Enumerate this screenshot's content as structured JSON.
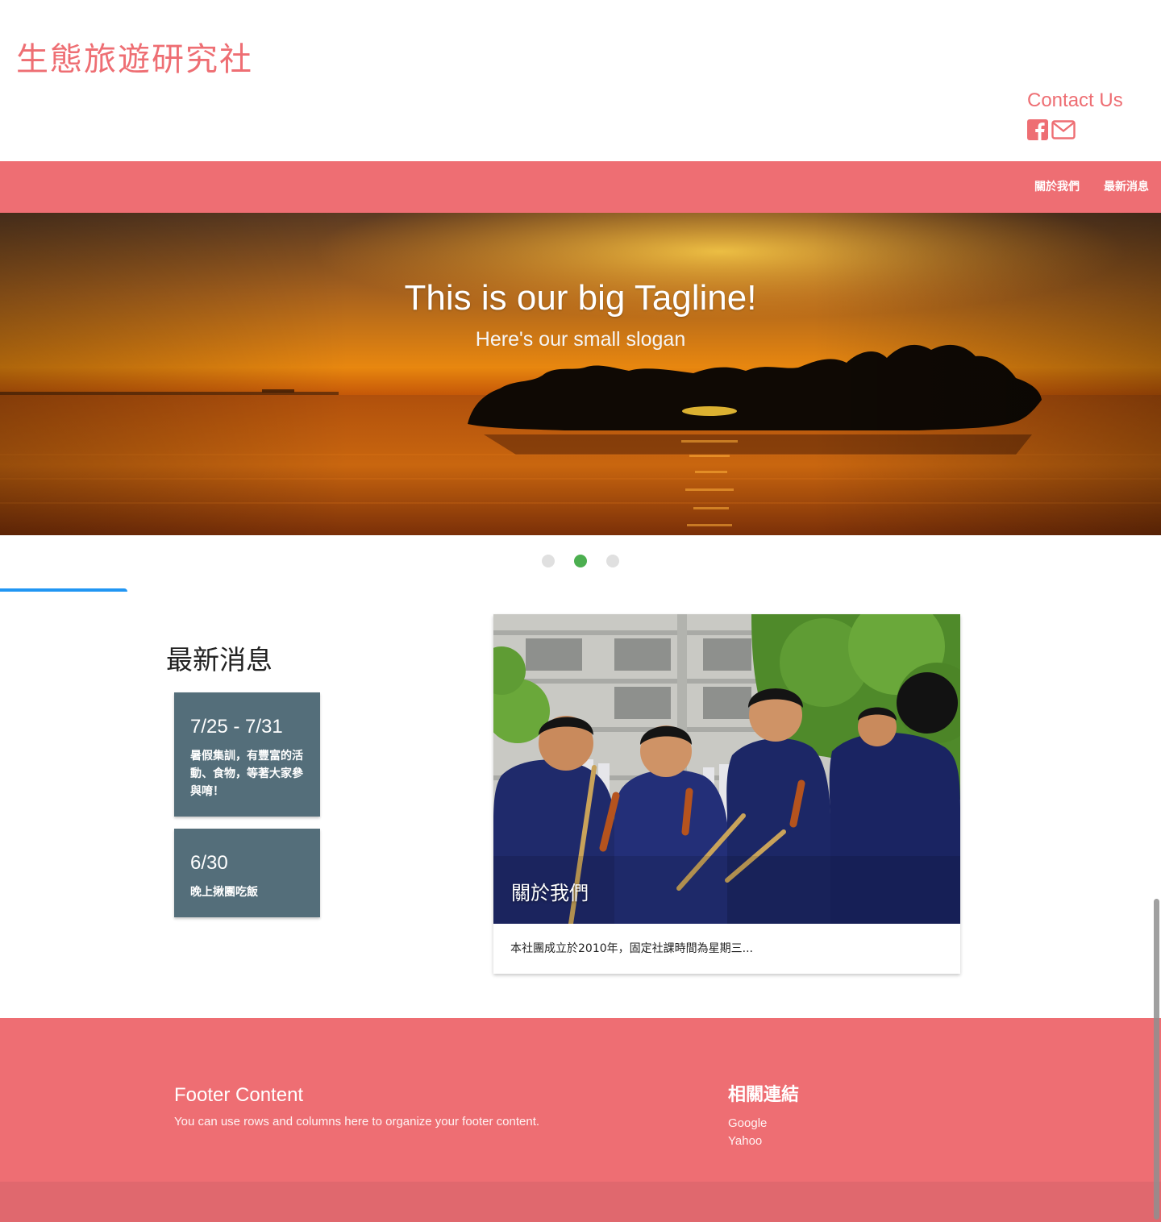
{
  "header": {
    "site_title": "生態旅遊研究社",
    "contact_label": "Contact Us",
    "social": [
      {
        "icon": "facebook-icon"
      },
      {
        "icon": "mail-icon"
      }
    ]
  },
  "nav": {
    "items": [
      {
        "label": "關於我們"
      },
      {
        "label": "最新消息"
      }
    ]
  },
  "hero": {
    "tagline": "This is our big Tagline!",
    "slogan": "Here's our small slogan",
    "active_slide": 2,
    "slide_count": 3
  },
  "news": {
    "heading": "最新消息",
    "items": [
      {
        "date": "7/25 - 7/31",
        "desc": "暑假集訓，有豐富的活動、食物，等著大家參與唷！"
      },
      {
        "date": "6/30",
        "desc": "晚上揪團吃飯"
      }
    ]
  },
  "about": {
    "title": "關於我們",
    "text": "本社團成立於2010年，固定社課時間為星期三..."
  },
  "footer": {
    "left_title": "Footer Content",
    "left_text": "You can use rows and columns here to organize your footer content.",
    "right_title": "相關連結",
    "links": [
      {
        "label": "Google"
      },
      {
        "label": "Yahoo"
      }
    ]
  },
  "colors": {
    "accent": "#ee6e73",
    "card": "#546e7a",
    "indicator_active": "#4caf50",
    "tab_indicator": "#2196f3"
  }
}
